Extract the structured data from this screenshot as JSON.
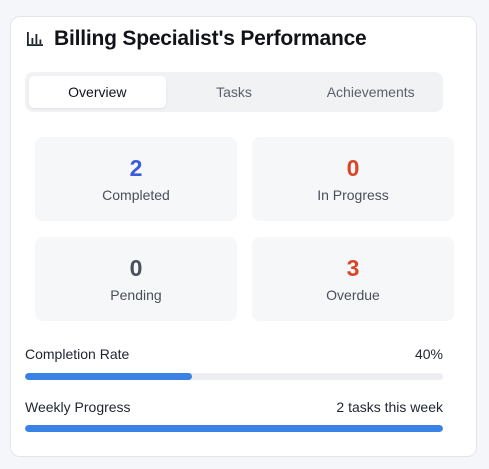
{
  "header": {
    "title": "Billing Specialist's Performance",
    "icon": "bar-chart-icon"
  },
  "tabs": [
    {
      "label": "Overview",
      "active": true
    },
    {
      "label": "Tasks",
      "active": false
    },
    {
      "label": "Achievements",
      "active": false
    }
  ],
  "stats": {
    "completed": {
      "value": "2",
      "label": "Completed",
      "color": "#3b5bdb"
    },
    "in_progress": {
      "value": "0",
      "label": "In Progress",
      "color": "#d9472b"
    },
    "pending": {
      "value": "0",
      "label": "Pending",
      "color": "#4a4f59"
    },
    "overdue": {
      "value": "3",
      "label": "Overdue",
      "color": "#d9472b"
    }
  },
  "completion_rate": {
    "label": "Completion Rate",
    "value_text": "40%",
    "percent": 40,
    "color": "#3b82e6"
  },
  "weekly_progress": {
    "label": "Weekly Progress",
    "value_text": "2 tasks this week",
    "percent": 100,
    "color": "#3b82e6"
  }
}
